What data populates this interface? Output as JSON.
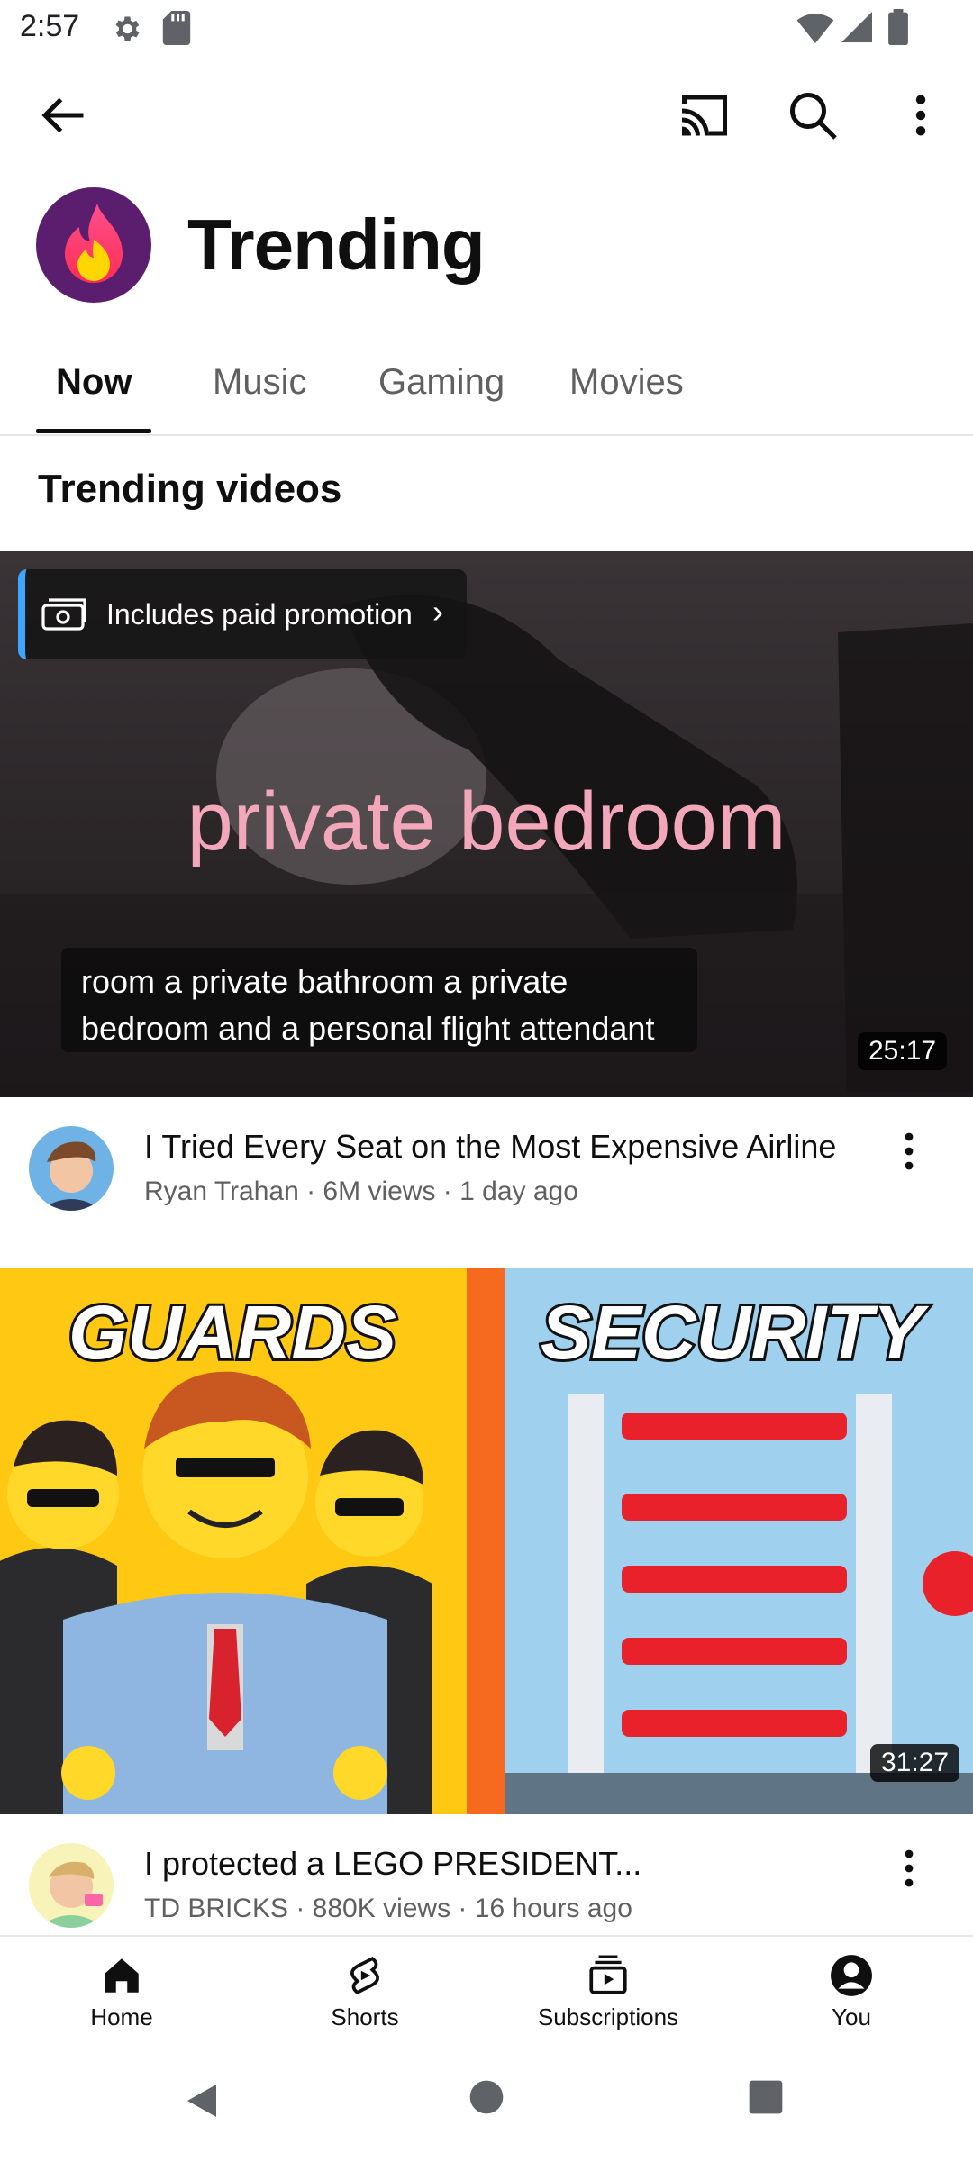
{
  "status_bar": {
    "time": "2:57",
    "icons": [
      "settings-icon",
      "sd-card-icon",
      "wifi-icon",
      "signal-icon",
      "battery-icon"
    ]
  },
  "app_bar": {
    "icons": [
      "back-arrow-icon",
      "cast-icon",
      "search-icon",
      "more-vert-icon"
    ]
  },
  "header": {
    "title": "Trending",
    "avatar_icon": "flame-icon"
  },
  "tabs": [
    {
      "label": "Now",
      "active": true
    },
    {
      "label": "Music",
      "active": false
    },
    {
      "label": "Gaming",
      "active": false
    },
    {
      "label": "Movies",
      "active": false
    }
  ],
  "section_title": "Trending videos",
  "videos": [
    {
      "promo_label": "Includes paid promotion",
      "caption_large": "private bedroom",
      "caption_line1": "room a private bathroom a private",
      "caption_line2": "bedroom and a personal flight attendant",
      "duration": "25:17",
      "title": "I Tried Every Seat on the Most Expensive Airline",
      "subtitle": "Ryan Trahan · 6M views · 1 day ago"
    },
    {
      "thumb_left_text": "GUARDS",
      "thumb_right_text": "SECURITY",
      "duration": "31:27",
      "title": "I protected a LEGO PRESIDENT...",
      "subtitle": "TD BRICKS · 880K views · 16 hours ago"
    }
  ],
  "bottom_nav": [
    {
      "label": "Home",
      "icon": "home-icon"
    },
    {
      "label": "Shorts",
      "icon": "shorts-icon"
    },
    {
      "label": "Subscriptions",
      "icon": "subscriptions-icon"
    },
    {
      "label": "You",
      "icon": "account-icon"
    }
  ],
  "system_nav": {
    "icons": [
      "nav-back-icon",
      "nav-home-icon",
      "nav-recents-icon"
    ]
  },
  "colors": {
    "accent": "#3ea6ff",
    "caption_pink": "#f3a7bb",
    "text_secondary": "#606060"
  }
}
